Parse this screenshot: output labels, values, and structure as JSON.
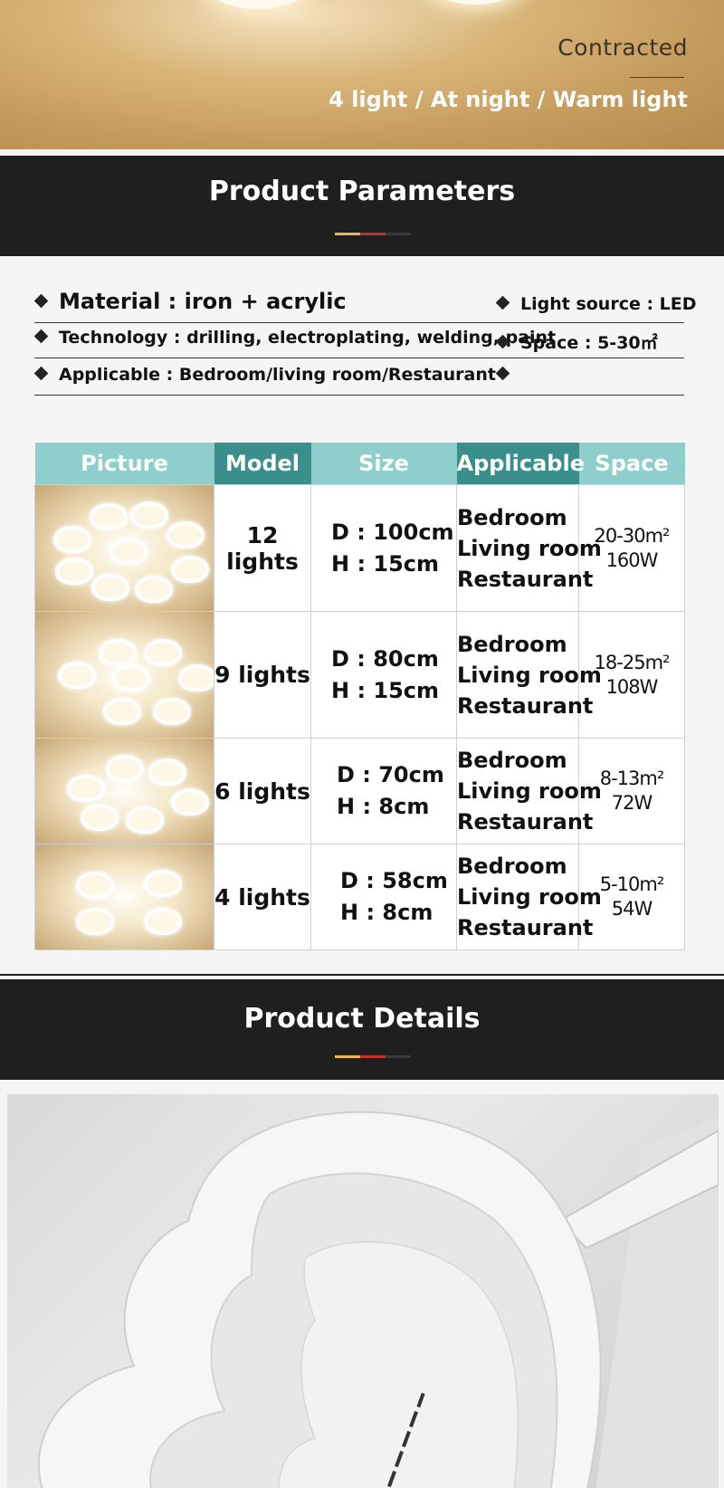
{
  "hero": {
    "label": "Contracted",
    "caption": "4 light / At night / Warm light"
  },
  "section_params": {
    "title": "Product Parameters",
    "accent_colors": [
      "#e8b64a",
      "#c9302c",
      "#3a3a3a"
    ]
  },
  "params": {
    "rows": [
      {
        "left": "Material : iron + acrylic",
        "right": "Light source : LED"
      },
      {
        "left": "Technology : drilling, electroplating, welding, paint",
        "right": "Space : 5-30㎡"
      },
      {
        "left": "Applicable : Bedroom/living room/Restaurant",
        "right": ""
      }
    ]
  },
  "table": {
    "header_colors": {
      "light": "#8ecfce",
      "dark": "#3a8f8d"
    },
    "headers": [
      "Picture",
      "Model",
      "Size",
      "Applicable",
      "Space"
    ],
    "rows": [
      {
        "model": "12 lights",
        "size_d": "D : 100cm",
        "size_h": "H : 15cm",
        "app": [
          "Bedroom",
          "Living room",
          "Restaurant"
        ],
        "area": "20-30m²",
        "watt": "160W"
      },
      {
        "model": "9 lights",
        "size_d": "D : 80cm",
        "size_h": "H : 15cm",
        "app": [
          "Bedroom",
          "Living room",
          "Restaurant"
        ],
        "area": "18-25m²",
        "watt": "108W"
      },
      {
        "model": "6 lights",
        "size_d": "D : 70cm",
        "size_h": "H : 8cm",
        "app": [
          "Bedroom",
          "Living room",
          "Restaurant"
        ],
        "area": "8-13m²",
        "watt": "72W"
      },
      {
        "model": "4 lights",
        "size_d": "D : 58cm",
        "size_h": "H : 8cm",
        "app": [
          "Bedroom",
          "Living room",
          "Restaurant"
        ],
        "area": "5-10m²",
        "watt": "54W"
      }
    ]
  },
  "section_details": {
    "title": "Product Details"
  }
}
